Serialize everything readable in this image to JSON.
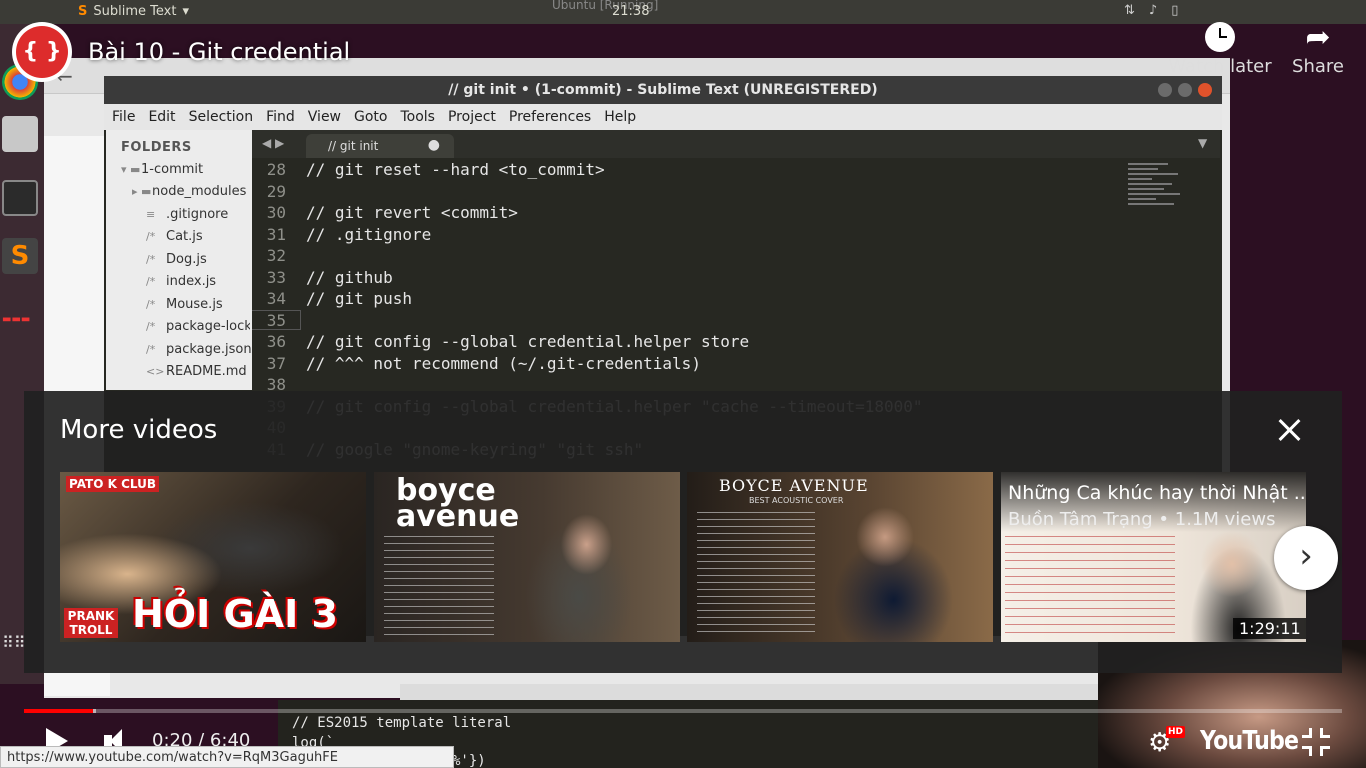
{
  "desktop": {
    "topbar_app": "Sublime Text",
    "topbar_app_arrow": "▾",
    "clock": "21:38",
    "vm_title": "Ubuntu [Running]"
  },
  "sublime": {
    "title": "// git init • (1-commit) - Sublime Text (UNREGISTERED)",
    "menu": [
      "File",
      "Edit",
      "Selection",
      "Find",
      "View",
      "Goto",
      "Tools",
      "Project",
      "Preferences",
      "Help"
    ],
    "folders_header": "FOLDERS",
    "tree": [
      {
        "icon": "folder-open-icon",
        "glyph": "▾ ▬",
        "label": "1-commit"
      },
      {
        "icon": "folder-icon",
        "glyph": "▸ ▬",
        "label": "node_modules"
      },
      {
        "icon": "file-lines-icon",
        "glyph": "≡",
        "label": ".gitignore"
      },
      {
        "icon": "js-file-icon",
        "glyph": "/*",
        "label": "Cat.js"
      },
      {
        "icon": "js-file-icon",
        "glyph": "/*",
        "label": "Dog.js"
      },
      {
        "icon": "js-file-icon",
        "glyph": "/*",
        "label": "index.js"
      },
      {
        "icon": "js-file-icon",
        "glyph": "/*",
        "label": "Mouse.js"
      },
      {
        "icon": "js-file-icon",
        "glyph": "/*",
        "label": "package-lock.j"
      },
      {
        "icon": "js-file-icon",
        "glyph": "/*",
        "label": "package.json"
      },
      {
        "icon": "markup-file-icon",
        "glyph": "<>",
        "label": "README.md"
      }
    ],
    "tab_label": "// git init",
    "tab_dirty": "●",
    "lines": [
      {
        "n": "28",
        "code": "// git reset --hard <to_commit>"
      },
      {
        "n": "29",
        "code": ""
      },
      {
        "n": "30",
        "code": "// git revert <commit>"
      },
      {
        "n": "31",
        "code": "// .gitignore"
      },
      {
        "n": "32",
        "code": ""
      },
      {
        "n": "33",
        "code": "// github"
      },
      {
        "n": "34",
        "code": "// git push"
      },
      {
        "n": "35",
        "code": ""
      },
      {
        "n": "36",
        "code": "// git config --global credential.helper store"
      },
      {
        "n": "37",
        "code": "// ^^^ not recommend (~/.git-credentials)"
      },
      {
        "n": "38",
        "code": ""
      },
      {
        "n": "39",
        "code": "// git config --global credential.helper \"cache --timeout=18000\""
      },
      {
        "n": "40",
        "code": ""
      },
      {
        "n": "41",
        "code": "// google \"gnome-keyring\" \"git ssh\""
      }
    ],
    "lower_lines": [
      "// ES2015 template literal",
      "log(`",
      "%'})"
    ]
  },
  "youtube": {
    "video_title": "Bài 10 - Git credential",
    "watch_later": "Watch later",
    "share": "Share",
    "more_videos_title": "More videos",
    "thumbnails": [
      {
        "badge": "PATO K CLUB",
        "big_text": "HỎI GÀI 3",
        "corner": "PRANK TROLL"
      },
      {
        "brand": "boyce avenue"
      },
      {
        "brand": "BOYCE AVENUE",
        "subtitle": "BEST ACOUSTIC COVER"
      },
      {
        "title": "Những Ca khúc hay thời Nhật ...",
        "meta": "Buồn Tâm Trạng • 1.1M views",
        "duration": "1:29:11"
      }
    ],
    "progress_fraction": 0.052,
    "time": "0:20 / 6:40",
    "hd_badge": "HD",
    "brand": "YouTube",
    "status_url": "https://www.youtube.com/watch?v=RqM3GaguhFE"
  },
  "colors": {
    "accent_red": "#ff0000",
    "sublime_bg": "#272822",
    "overlay_bg": "#212121"
  }
}
